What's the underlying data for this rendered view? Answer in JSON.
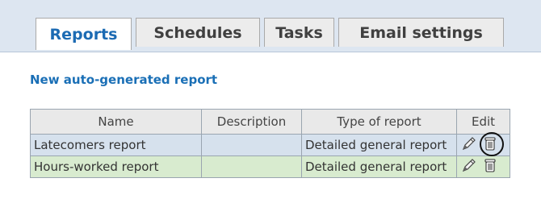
{
  "tabs": [
    {
      "label": "Reports",
      "active": true
    },
    {
      "label": "Schedules",
      "active": false
    },
    {
      "label": "Tasks",
      "active": false
    },
    {
      "label": "Email settings",
      "active": false
    }
  ],
  "new_report_link": "New auto-generated report",
  "table": {
    "headers": {
      "name": "Name",
      "description": "Description",
      "type": "Type of report",
      "edit": "Edit"
    },
    "rows": [
      {
        "name": "Latecomers report",
        "description": "",
        "type": "Detailed general report",
        "row_color": "#d6e1ed"
      },
      {
        "name": "Hours-worked report",
        "description": "",
        "type": "Detailed general report",
        "row_color": "#d8ebcf"
      }
    ]
  },
  "icons": {
    "edit": "pencil-icon",
    "delete": "trash-icon"
  },
  "colors": {
    "accent": "#1a6fb6",
    "tabbar_bg": "#dde6f1",
    "header_bg": "#e9e9e9"
  }
}
